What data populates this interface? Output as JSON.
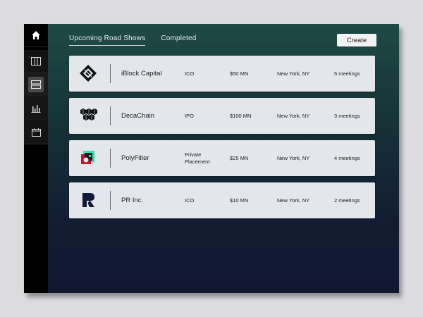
{
  "tabs": [
    {
      "label": "Upcoming Road Shows",
      "active": true
    },
    {
      "label": "Completed",
      "active": false
    }
  ],
  "create_label": "Create",
  "sidebar": {
    "items": [
      {
        "icon": "home-icon"
      },
      {
        "icon": "columns-icon"
      },
      {
        "icon": "list-icon",
        "active": true
      },
      {
        "icon": "bar-chart-icon"
      },
      {
        "icon": "calendar-icon"
      }
    ]
  },
  "roadshows": [
    {
      "name": "iBlock Capital",
      "type": "ICO",
      "amount": "$50 MN",
      "location": "New York, NY",
      "meetings": "5 meetings",
      "logo": "iblock-logo"
    },
    {
      "name": "DecaChain",
      "type": "IPO",
      "amount": "$100 MN",
      "location": "New York, NY",
      "meetings": "3 meetings",
      "logo": "decachain-logo"
    },
    {
      "name": "PolyFilter",
      "type": "Private Placement",
      "amount": "$25 MN",
      "location": "New York, NY",
      "meetings": "4 meetings",
      "logo": "polyfilter-logo"
    },
    {
      "name": "PR Inc.",
      "type": "ICO",
      "amount": "$10 MN",
      "location": "New York, NY",
      "meetings": "2 meetings",
      "logo": "pr-logo"
    }
  ]
}
